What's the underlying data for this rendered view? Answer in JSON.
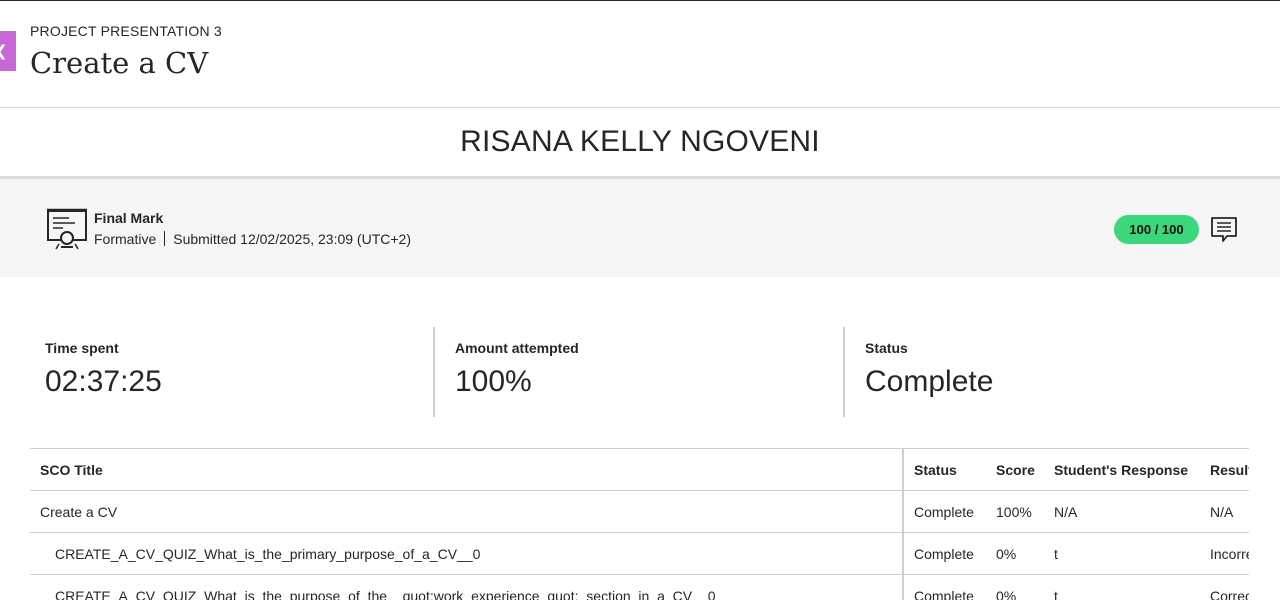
{
  "header": {
    "back_icon": "chevron-left-icon",
    "eyebrow": "PROJECT PRESENTATION 3",
    "title": "Create a CV"
  },
  "student": {
    "name": "RISANA KELLY NGOVENI"
  },
  "grade": {
    "icon": "presentation-board-icon",
    "label": "Final Mark",
    "type": "Formative",
    "submitted": "Submitted 12/02/2025, 23:09 (UTC+2)",
    "score": "100 / 100",
    "score_color": "#3ad87a",
    "feedback_icon": "comment-icon"
  },
  "stats": [
    {
      "label": "Time spent",
      "value": "02:37:25"
    },
    {
      "label": "Amount attempted",
      "value": "100%"
    },
    {
      "label": "Status",
      "value": "Complete"
    }
  ],
  "table": {
    "headers": [
      "SCO Title",
      "Status",
      "Score",
      "Student's Response",
      "Result"
    ],
    "rows": [
      {
        "title": "Create a CV",
        "status": "Complete",
        "score": "100%",
        "response": "N/A",
        "result": "N/A"
      },
      {
        "title": "CREATE_A_CV_QUIZ_What_is_the_primary_purpose_of_a_CV__0",
        "status": "Complete",
        "score": "0%",
        "response": "t",
        "result": "Incorrect"
      },
      {
        "title": "CREATE_A_CV_QUIZ_What_is_the_purpose_of_the__quot;work_experience_quot;_section_in_a_CV__0",
        "status": "Complete",
        "score": "0%",
        "response": "t",
        "result": "Correct"
      }
    ]
  },
  "colors": {
    "accent": "#c668d6",
    "score_pill": "#3ad87a",
    "band": "#f6f6f6"
  }
}
